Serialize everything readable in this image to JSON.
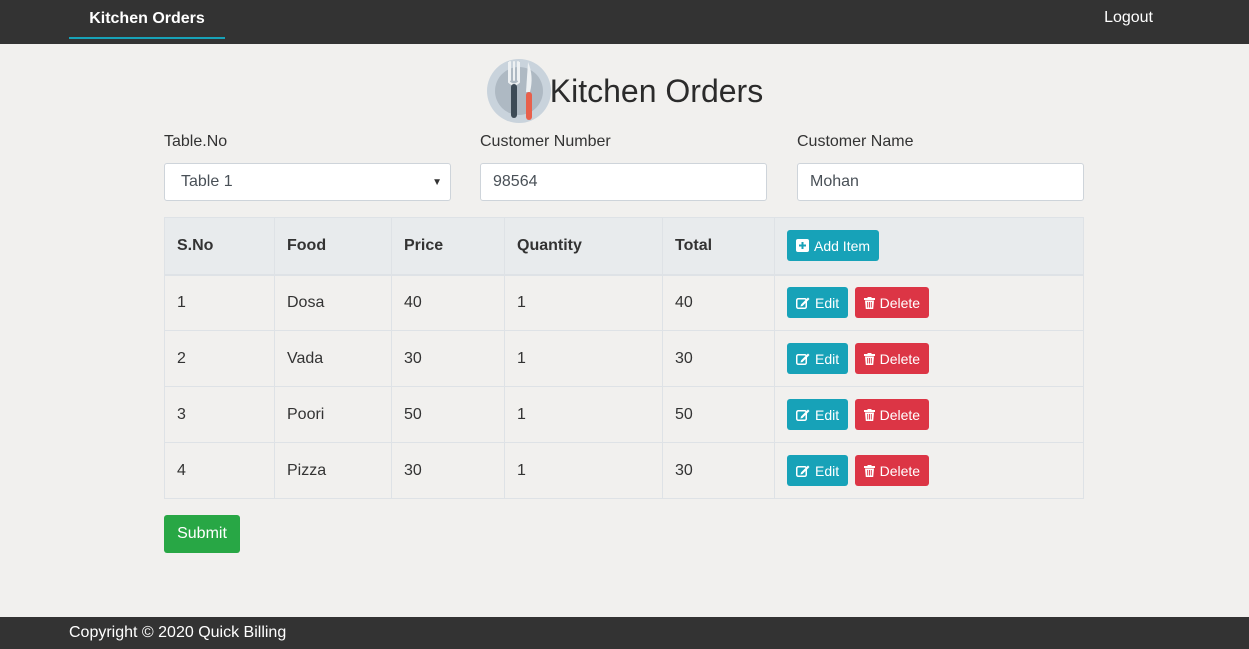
{
  "nav": {
    "brand": "Kitchen Orders",
    "logout": "Logout"
  },
  "header": {
    "title": "Kitchen Orders",
    "logo_icon": "plate-fork-knife-icon"
  },
  "form": {
    "table_no": {
      "label": "Table.No",
      "value": "Table 1"
    },
    "customer_number": {
      "label": "Customer Number",
      "value": "98564"
    },
    "customer_name": {
      "label": "Customer Name",
      "value": "Mohan"
    }
  },
  "table": {
    "headers": [
      "S.No",
      "Food",
      "Price",
      "Quantity",
      "Total"
    ],
    "add_item_label": "Add Item",
    "edit_label": "Edit",
    "delete_label": "Delete",
    "rows": [
      {
        "sno": "1",
        "food": "Dosa",
        "price": "40",
        "quantity": "1",
        "total": "40"
      },
      {
        "sno": "2",
        "food": "Vada",
        "price": "30",
        "quantity": "1",
        "total": "30"
      },
      {
        "sno": "3",
        "food": "Poori",
        "price": "50",
        "quantity": "1",
        "total": "50"
      },
      {
        "sno": "4",
        "food": "Pizza",
        "price": "30",
        "quantity": "1",
        "total": "30"
      }
    ]
  },
  "submit_label": "Submit",
  "footer": {
    "copyright": "Copyright © 2020 Quick Billing"
  },
  "colors": {
    "navbar": "#333333",
    "info": "#17a2b8",
    "danger": "#dc3545",
    "success": "#28a745",
    "background": "#f1f0ee"
  }
}
